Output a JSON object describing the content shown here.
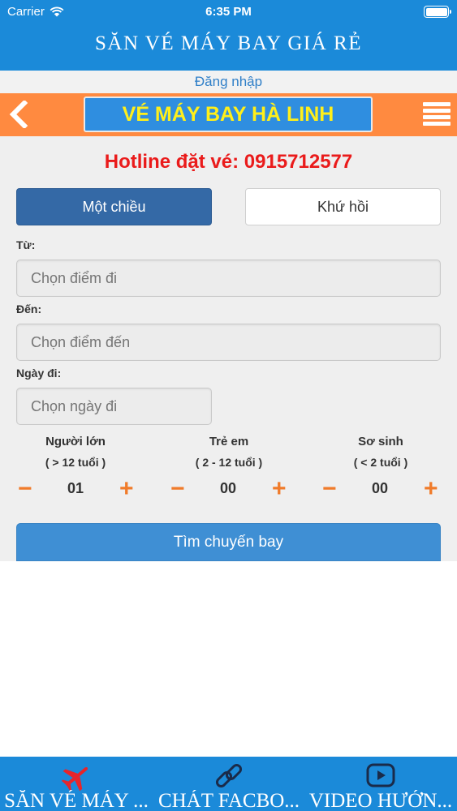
{
  "status_bar": {
    "carrier": "Carrier",
    "time": "6:35 PM"
  },
  "header": {
    "title": "SĂN VÉ MÁY BAY GIÁ RẺ"
  },
  "login": {
    "label": "Đăng nhập"
  },
  "nav": {
    "brand": "VÉ MÁY BAY HÀ LINH",
    "back_icon": "chevron-left-icon",
    "menu_icon": "hamburger-menu-icon"
  },
  "hotline": "Hotline đặt vé: 0915712577",
  "trip_type": {
    "one_way": "Một chiều",
    "round_trip": "Khứ hồi",
    "selected": "one_way"
  },
  "from": {
    "label": "Từ:",
    "placeholder": "Chọn điểm đi"
  },
  "to": {
    "label": "Đến:",
    "placeholder": "Chọn điểm đến"
  },
  "date": {
    "label": "Ngày đi:",
    "placeholder": "Chọn ngày đi"
  },
  "passengers": [
    {
      "title": "Người lớn",
      "range": "( > 12 tuổi )",
      "count": "01"
    },
    {
      "title": "Trẻ em",
      "range": "( 2 - 12 tuổi )",
      "count": "00"
    },
    {
      "title": "Sơ sinh",
      "range": "( < 2 tuổi )",
      "count": "00"
    }
  ],
  "counter_symbols": {
    "minus": "−",
    "plus": "+"
  },
  "search_button": "Tìm chuyến bay",
  "tabs": [
    {
      "label": "SĂN VÉ MÁY ...",
      "icon": "airplane-icon",
      "active": true
    },
    {
      "label": "CHÁT FACBO...",
      "icon": "link-icon",
      "active": false
    },
    {
      "label": "VIDEO HƯỚN...",
      "icon": "youtube-play-icon",
      "active": false
    }
  ],
  "colors": {
    "primary": "#1b8ad9",
    "nav_orange": "#ff8a40",
    "brand_yellow": "#ffef1a",
    "hotline_red": "#ea1b1b",
    "accent_orange": "#f07b2a",
    "active_segment": "#3469a6"
  }
}
